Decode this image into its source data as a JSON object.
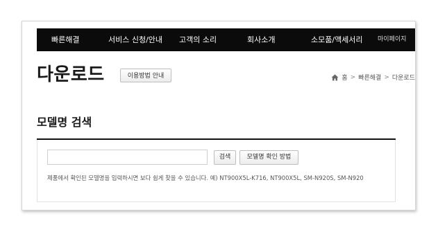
{
  "nav": {
    "items": [
      {
        "label": "빠른해결"
      },
      {
        "label": "서비스 신청/안내"
      },
      {
        "label": "고객의 소리"
      },
      {
        "label": "회사소개"
      },
      {
        "label": "소모품/액세서리"
      },
      {
        "label": "마이페이지"
      }
    ]
  },
  "header": {
    "title": "다운로드",
    "guide_button": "이용방법 안내"
  },
  "breadcrumb": {
    "home": "홈",
    "items": [
      "빠른해결",
      "다운로드"
    ],
    "separator": ">"
  },
  "model_search": {
    "title": "모델명 검색",
    "input_value": "",
    "search_button": "검색",
    "howto_button": "모델명 확인 방법",
    "help_text": "제품에서 확인된 모델명을 입력하시면 보다 쉽게 찾을 수 있습니다. 예) NT900X5L-K716, NT900X5L, SM-N920S, SM-N920"
  },
  "colors": {
    "nav_background": "#0b0b0b",
    "nav_text": "#ffffff",
    "rule": "#111111"
  },
  "icons": {
    "home": "home-icon",
    "separator": "chevron-right-icon"
  }
}
